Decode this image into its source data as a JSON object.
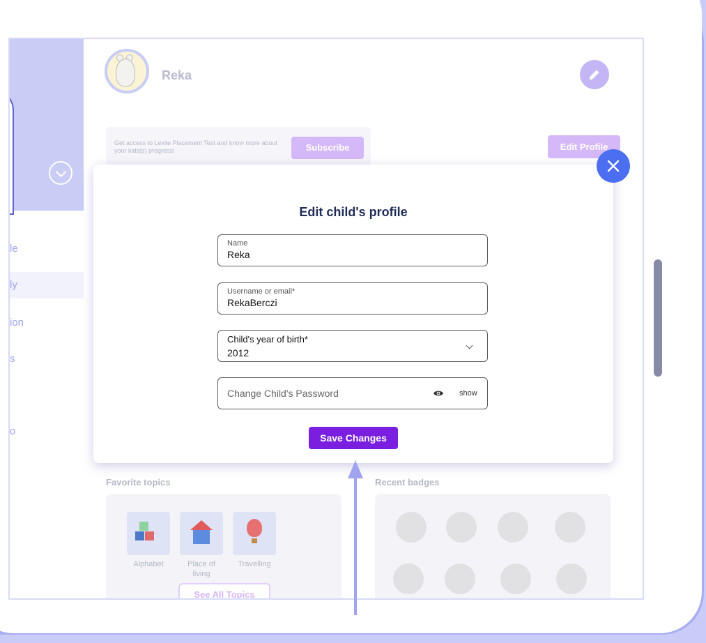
{
  "profile": {
    "name": "Reka"
  },
  "promo": {
    "text": "Get access to Lexile Placement Test and know more about your kids(s) progress!",
    "subscribe_label": "Subscribe"
  },
  "edit_profile_label": "Edit Profile",
  "sidebar": {
    "items": [
      {
        "label": "le"
      },
      {
        "label": "ly"
      },
      {
        "label": "ion"
      },
      {
        "label": "s"
      },
      {
        "label": "o"
      }
    ]
  },
  "modal": {
    "title": "Edit child's profile",
    "name_label": "Name",
    "name_value": "Reka",
    "username_label": "Username or email*",
    "username_value": "RekaBerczi",
    "birth_label": "Child's year of birth*",
    "birth_value": "2012",
    "password_placeholder": "Change Child's Password",
    "show_label": "show",
    "save_label": "Save Changes"
  },
  "favorite_topics": {
    "title": "Favorite topics",
    "topics": [
      {
        "label": "Alphabet",
        "icon": "abc-blocks-icon"
      },
      {
        "label": "Place of living",
        "icon": "house-icon"
      },
      {
        "label": "Travelling",
        "icon": "hot-air-balloon-icon"
      }
    ],
    "see_all_label": "See All Topics"
  },
  "recent_badges": {
    "title": "Recent badges"
  },
  "colors": {
    "accent_purple": "#7a1fe0",
    "close_blue": "#4b6ff0",
    "frame_lavender": "#a9adf2"
  }
}
